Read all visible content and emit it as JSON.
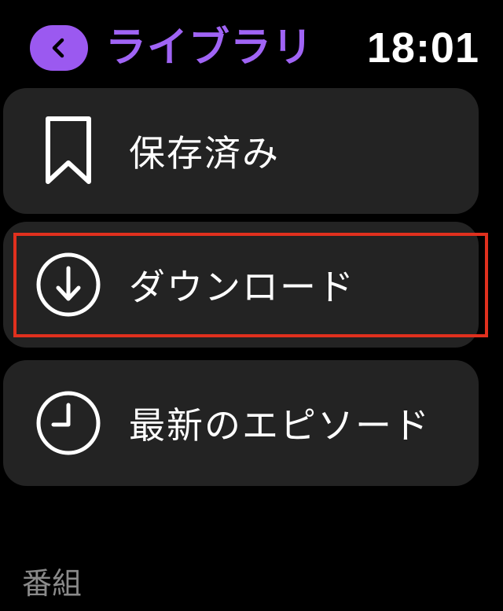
{
  "header": {
    "title": "ライブラリ",
    "time": "18:01",
    "back_icon": "chevron-left-icon"
  },
  "menu": {
    "items": [
      {
        "label": "保存済み",
        "icon": "bookmark-icon"
      },
      {
        "label": "ダウンロード",
        "icon": "download-circle-icon"
      },
      {
        "label": "最新のエピソード",
        "icon": "clock-icon"
      }
    ]
  },
  "section": {
    "title": "番組"
  },
  "colors": {
    "accent": "#a064f5",
    "back_button_bg": "#9b59f0",
    "card_bg": "#232323",
    "highlight": "#e0301e",
    "background": "#000000"
  }
}
